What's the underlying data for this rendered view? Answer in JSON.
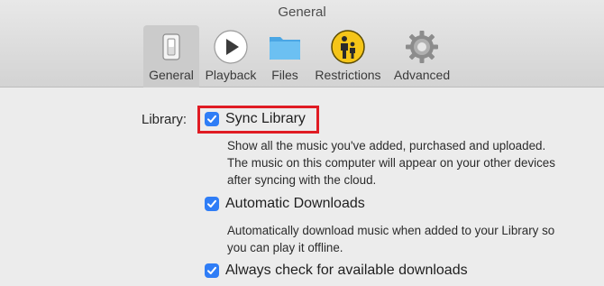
{
  "window": {
    "title": "General"
  },
  "tabs": [
    {
      "label": "General",
      "icon": "switch-icon",
      "active": true
    },
    {
      "label": "Playback",
      "icon": "play-icon"
    },
    {
      "label": "Files",
      "icon": "folder-icon"
    },
    {
      "label": "Restrictions",
      "icon": "restrictions-icon"
    },
    {
      "label": "Advanced",
      "icon": "gear-icon"
    }
  ],
  "settings": {
    "library_label": "Library:",
    "options": [
      {
        "label": "Sync Library",
        "checked": true,
        "description": "Show all the music you've added, purchased and uploaded. The music on this computer will appear on your other devices after syncing with the cloud."
      },
      {
        "label": "Automatic Downloads",
        "checked": true,
        "description": "Automatically download music when added to your Library so you can play it offline."
      },
      {
        "label": "Always check for available downloads",
        "checked": true
      }
    ]
  },
  "colors": {
    "checkbox": "#2f7df6",
    "highlight": "#e01b23",
    "folder": "#5ab4ec",
    "restrictions": "#f5c518"
  }
}
